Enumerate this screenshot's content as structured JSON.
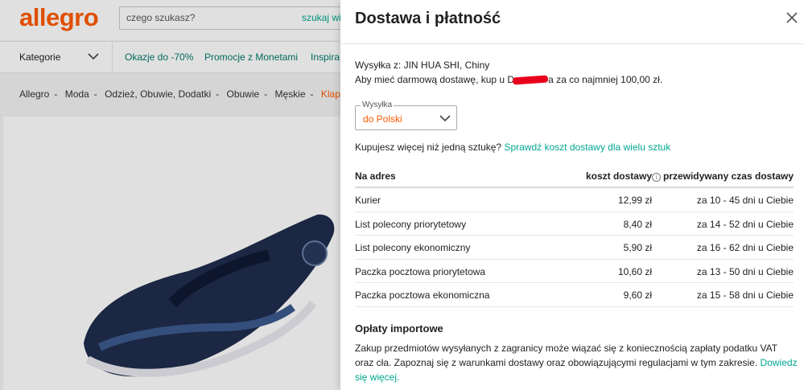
{
  "header": {
    "logo": "allegro",
    "search_placeholder": "czego szukasz?",
    "search_button": "szukaj wie"
  },
  "nav": {
    "categories": "Kategorie",
    "links": [
      "Okazje do -70%",
      "Promocje z Monetami",
      "Inspira"
    ]
  },
  "breadcrumb": [
    "Allegro",
    "Moda",
    "Odzież, Obuwie, Dodatki",
    "Obuwie",
    "Męskie",
    "Klapki"
  ],
  "modal": {
    "title": "Dostawa i płatność",
    "ship_from": "Wysyłka z: JIN HUA SHI, Chiny",
    "free_ship_prefix": "Aby mieć darmową dostawę, kup u D",
    "free_ship_suffix": "a za co najmniej 100,00 zł.",
    "select_label": "Wysyłka",
    "select_value": "do Polski",
    "more_items_text": "Kupujesz więcej niż jedną sztukę?",
    "more_items_link": "Sprawdź koszt dostawy dla wielu sztuk",
    "table": {
      "headers": [
        "Na adres",
        "koszt dostawy",
        "przewidywany czas dostawy"
      ],
      "rows": [
        {
          "name": "Kurier",
          "cost": "12,99 zł",
          "time": "za 10 - 45 dni u Ciebie"
        },
        {
          "name": "List polecony priorytetowy",
          "cost": "8,40 zł",
          "time": "za 14 - 52 dni u Ciebie"
        },
        {
          "name": "List polecony ekonomiczny",
          "cost": "5,90 zł",
          "time": "za 16 - 62 dni u Ciebie"
        },
        {
          "name": "Paczka pocztowa priorytetowa",
          "cost": "10,60 zł",
          "time": "za 13 - 50 dni u Ciebie"
        },
        {
          "name": "Paczka pocztowa ekonomiczna",
          "cost": "9,60 zł",
          "time": "za 15 - 58 dni u Ciebie"
        }
      ]
    },
    "import_title": "Opłaty importowe",
    "import_text": "Zakup przedmiotów wysyłanych z zagranicy może wiązać się z koniecznością zapłaty podatku VAT oraz cła. Zapoznaj się z warunkami dostawy oraz obowiązującymi regulacjami w tym zakresie.",
    "import_link": "Dowiedz się więcej."
  },
  "colors": {
    "brand": "#ff5a00",
    "link": "#00a790"
  }
}
